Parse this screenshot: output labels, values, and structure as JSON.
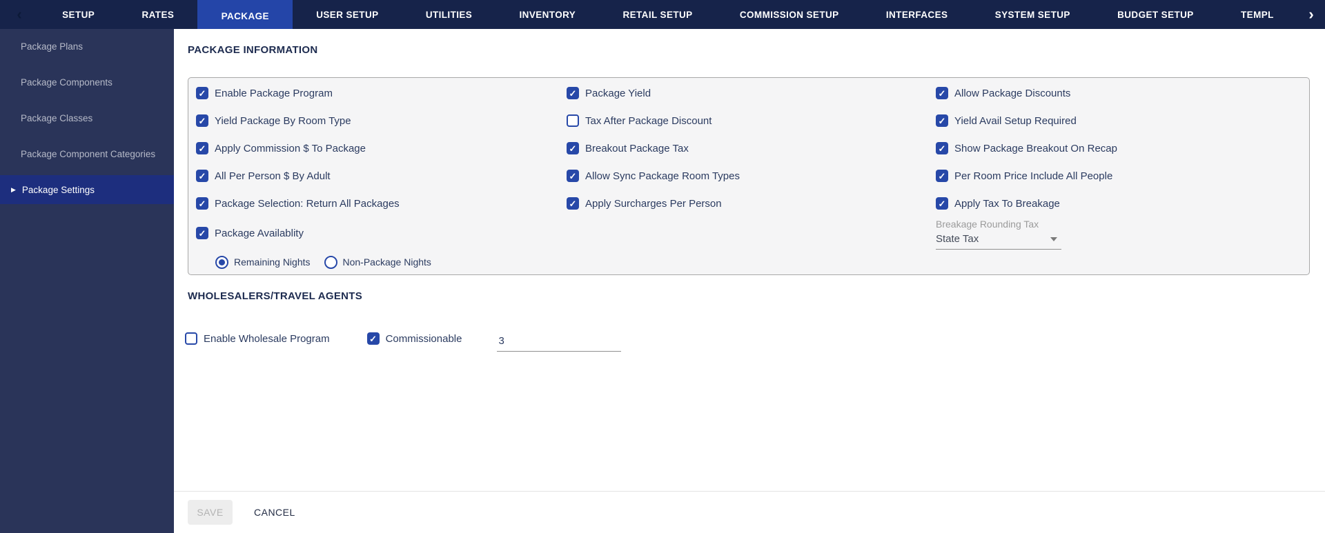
{
  "nav": {
    "back_icon": "‹",
    "forward_icon": "›",
    "tabs": [
      {
        "label": "SETUP",
        "active": false
      },
      {
        "label": "RATES",
        "active": false
      },
      {
        "label": "PACKAGE",
        "active": true
      },
      {
        "label": "USER SETUP",
        "active": false
      },
      {
        "label": "UTILITIES",
        "active": false
      },
      {
        "label": "INVENTORY",
        "active": false
      },
      {
        "label": "RETAIL SETUP",
        "active": false
      },
      {
        "label": "COMMISSION SETUP",
        "active": false
      },
      {
        "label": "INTERFACES",
        "active": false
      },
      {
        "label": "SYSTEM SETUP",
        "active": false
      },
      {
        "label": "BUDGET SETUP",
        "active": false
      },
      {
        "label": "TEMPL",
        "active": false
      }
    ]
  },
  "sidebar": {
    "active_marker_icon": "▶",
    "items": [
      {
        "label": "Package Plans",
        "active": false
      },
      {
        "label": "Package Components",
        "active": false
      },
      {
        "label": "Package Classes",
        "active": false
      },
      {
        "label": "Package Component Categories",
        "active": false
      },
      {
        "label": "Package Settings",
        "active": true
      }
    ]
  },
  "package_info": {
    "title": "PACKAGE INFORMATION",
    "columns": [
      {
        "items": [
          {
            "label": "Enable Package Program",
            "checked": true
          },
          {
            "label": "Yield Package By Room Type",
            "checked": true
          },
          {
            "label": "Apply Commission $ To Package",
            "checked": true
          },
          {
            "label": "All Per Person $ By Adult",
            "checked": true
          },
          {
            "label": "Package Selection: Return All Packages",
            "checked": true
          },
          {
            "label": "Package Availablity",
            "checked": true
          }
        ]
      },
      {
        "items": [
          {
            "label": "Package Yield",
            "checked": true
          },
          {
            "label": "Tax After Package Discount",
            "checked": false
          },
          {
            "label": "Breakout Package Tax",
            "checked": true
          },
          {
            "label": "Allow Sync Package Room Types",
            "checked": true
          },
          {
            "label": "Apply Surcharges Per Person",
            "checked": true
          }
        ]
      },
      {
        "items": [
          {
            "label": "Allow Package Discounts",
            "checked": true
          },
          {
            "label": "Yield Avail Setup Required",
            "checked": true
          },
          {
            "label": "Show Package Breakout On Recap",
            "checked": true
          },
          {
            "label": "Per Room Price Include All People",
            "checked": true
          },
          {
            "label": "Apply Tax To Breakage",
            "checked": true
          }
        ]
      }
    ],
    "availability_radios": [
      {
        "label": "Remaining Nights",
        "selected": true
      },
      {
        "label": "Non-Package Nights",
        "selected": false
      }
    ],
    "breakage_rounding": {
      "label": "Breakage Rounding Tax",
      "value": "State Tax"
    }
  },
  "wholesalers": {
    "title": "WHOLESALERS/TRAVEL AGENTS",
    "checkboxes": [
      {
        "label": "Enable Wholesale Program",
        "checked": false
      },
      {
        "label": "Commissionable",
        "checked": true
      }
    ],
    "commission_input": {
      "value": "3"
    }
  },
  "footer": {
    "save_label": "SAVE",
    "cancel_label": "CANCEL"
  },
  "icons": {
    "checkmark": "✓"
  },
  "colors": {
    "nav_bg": "#16234a",
    "tab_active_bg": "#2445a8",
    "sidebar_bg": "#2a3459",
    "sidebar_active_bg": "#1d2e7e",
    "accent_blue": "#2748a8",
    "panel_bg": "#f5f5f6",
    "text_navy": "#2b3b60",
    "muted_gray": "#9b9b9b"
  }
}
